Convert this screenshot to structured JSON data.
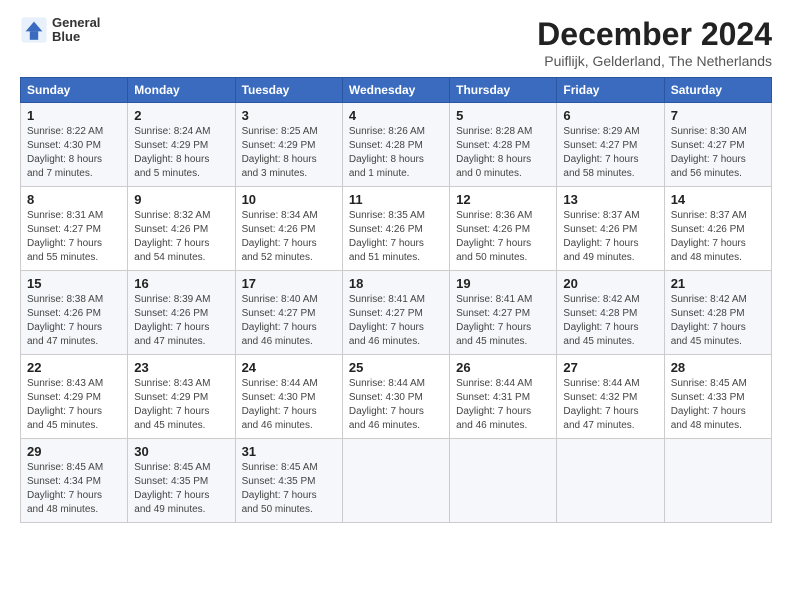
{
  "header": {
    "logo_line1": "General",
    "logo_line2": "Blue",
    "title": "December 2024",
    "subtitle": "Puiflijk, Gelderland, The Netherlands"
  },
  "calendar": {
    "days_of_week": [
      "Sunday",
      "Monday",
      "Tuesday",
      "Wednesday",
      "Thursday",
      "Friday",
      "Saturday"
    ],
    "weeks": [
      [
        {
          "day": "1",
          "sunrise": "8:22 AM",
          "sunset": "4:30 PM",
          "daylight": "8 hours and 7 minutes."
        },
        {
          "day": "2",
          "sunrise": "8:24 AM",
          "sunset": "4:29 PM",
          "daylight": "8 hours and 5 minutes."
        },
        {
          "day": "3",
          "sunrise": "8:25 AM",
          "sunset": "4:29 PM",
          "daylight": "8 hours and 3 minutes."
        },
        {
          "day": "4",
          "sunrise": "8:26 AM",
          "sunset": "4:28 PM",
          "daylight": "8 hours and 1 minute."
        },
        {
          "day": "5",
          "sunrise": "8:28 AM",
          "sunset": "4:28 PM",
          "daylight": "8 hours and 0 minutes."
        },
        {
          "day": "6",
          "sunrise": "8:29 AM",
          "sunset": "4:27 PM",
          "daylight": "7 hours and 58 minutes."
        },
        {
          "day": "7",
          "sunrise": "8:30 AM",
          "sunset": "4:27 PM",
          "daylight": "7 hours and 56 minutes."
        }
      ],
      [
        {
          "day": "8",
          "sunrise": "8:31 AM",
          "sunset": "4:27 PM",
          "daylight": "7 hours and 55 minutes."
        },
        {
          "day": "9",
          "sunrise": "8:32 AM",
          "sunset": "4:26 PM",
          "daylight": "7 hours and 54 minutes."
        },
        {
          "day": "10",
          "sunrise": "8:34 AM",
          "sunset": "4:26 PM",
          "daylight": "7 hours and 52 minutes."
        },
        {
          "day": "11",
          "sunrise": "8:35 AM",
          "sunset": "4:26 PM",
          "daylight": "7 hours and 51 minutes."
        },
        {
          "day": "12",
          "sunrise": "8:36 AM",
          "sunset": "4:26 PM",
          "daylight": "7 hours and 50 minutes."
        },
        {
          "day": "13",
          "sunrise": "8:37 AM",
          "sunset": "4:26 PM",
          "daylight": "7 hours and 49 minutes."
        },
        {
          "day": "14",
          "sunrise": "8:37 AM",
          "sunset": "4:26 PM",
          "daylight": "7 hours and 48 minutes."
        }
      ],
      [
        {
          "day": "15",
          "sunrise": "8:38 AM",
          "sunset": "4:26 PM",
          "daylight": "7 hours and 47 minutes."
        },
        {
          "day": "16",
          "sunrise": "8:39 AM",
          "sunset": "4:26 PM",
          "daylight": "7 hours and 47 minutes."
        },
        {
          "day": "17",
          "sunrise": "8:40 AM",
          "sunset": "4:27 PM",
          "daylight": "7 hours and 46 minutes."
        },
        {
          "day": "18",
          "sunrise": "8:41 AM",
          "sunset": "4:27 PM",
          "daylight": "7 hours and 46 minutes."
        },
        {
          "day": "19",
          "sunrise": "8:41 AM",
          "sunset": "4:27 PM",
          "daylight": "7 hours and 45 minutes."
        },
        {
          "day": "20",
          "sunrise": "8:42 AM",
          "sunset": "4:28 PM",
          "daylight": "7 hours and 45 minutes."
        },
        {
          "day": "21",
          "sunrise": "8:42 AM",
          "sunset": "4:28 PM",
          "daylight": "7 hours and 45 minutes."
        }
      ],
      [
        {
          "day": "22",
          "sunrise": "8:43 AM",
          "sunset": "4:29 PM",
          "daylight": "7 hours and 45 minutes."
        },
        {
          "day": "23",
          "sunrise": "8:43 AM",
          "sunset": "4:29 PM",
          "daylight": "7 hours and 45 minutes."
        },
        {
          "day": "24",
          "sunrise": "8:44 AM",
          "sunset": "4:30 PM",
          "daylight": "7 hours and 46 minutes."
        },
        {
          "day": "25",
          "sunrise": "8:44 AM",
          "sunset": "4:30 PM",
          "daylight": "7 hours and 46 minutes."
        },
        {
          "day": "26",
          "sunrise": "8:44 AM",
          "sunset": "4:31 PM",
          "daylight": "7 hours and 46 minutes."
        },
        {
          "day": "27",
          "sunrise": "8:44 AM",
          "sunset": "4:32 PM",
          "daylight": "7 hours and 47 minutes."
        },
        {
          "day": "28",
          "sunrise": "8:45 AM",
          "sunset": "4:33 PM",
          "daylight": "7 hours and 48 minutes."
        }
      ],
      [
        {
          "day": "29",
          "sunrise": "8:45 AM",
          "sunset": "4:34 PM",
          "daylight": "7 hours and 48 minutes."
        },
        {
          "day": "30",
          "sunrise": "8:45 AM",
          "sunset": "4:35 PM",
          "daylight": "7 hours and 49 minutes."
        },
        {
          "day": "31",
          "sunrise": "8:45 AM",
          "sunset": "4:35 PM",
          "daylight": "7 hours and 50 minutes."
        },
        null,
        null,
        null,
        null
      ]
    ]
  }
}
